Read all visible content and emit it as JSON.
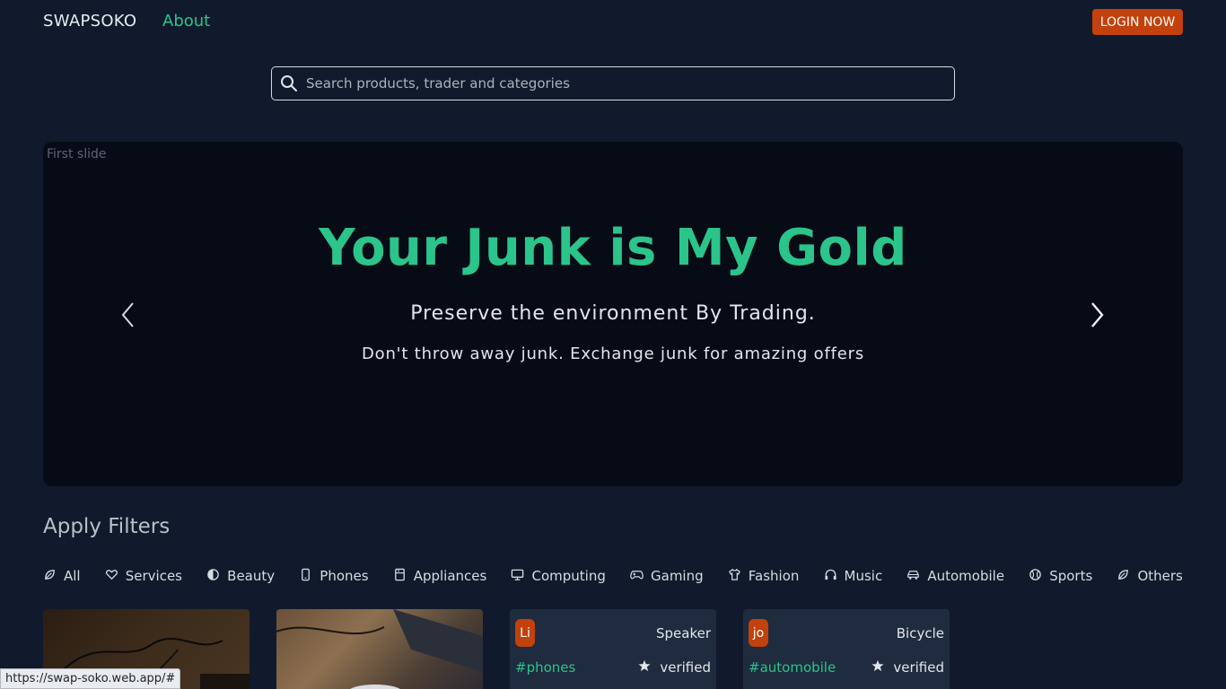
{
  "nav": {
    "brand": "SWAPSOKO",
    "about": "About",
    "login": "LOGIN NOW"
  },
  "search": {
    "placeholder": "Search products, trader and categories"
  },
  "carousel": {
    "alt": "First slide",
    "title": "Your Junk is My Gold",
    "subtitle": "Preserve the environment By Trading.",
    "description": "Don't throw away junk. Exchange junk for amazing offers"
  },
  "filters": {
    "title": "Apply Filters",
    "items": [
      {
        "label": "All",
        "icon": "leaf-icon"
      },
      {
        "label": "Services",
        "icon": "hand-heart-icon"
      },
      {
        "label": "Beauty",
        "icon": "contrast-icon"
      },
      {
        "label": "Phones",
        "icon": "phone-icon"
      },
      {
        "label": "Appliances",
        "icon": "appliance-icon"
      },
      {
        "label": "Computing",
        "icon": "monitor-icon"
      },
      {
        "label": "Gaming",
        "icon": "gamepad-icon"
      },
      {
        "label": "Fashion",
        "icon": "shirt-icon"
      },
      {
        "label": "Music",
        "icon": "headphones-icon"
      },
      {
        "label": "Automobile",
        "icon": "car-icon"
      },
      {
        "label": "Sports",
        "icon": "ball-icon"
      },
      {
        "label": "Others",
        "icon": "leaf-icon"
      }
    ]
  },
  "cards": [
    {
      "avatar": "Li",
      "name": "Speaker",
      "tag": "#phones",
      "status": "verified"
    },
    {
      "avatar": "jo",
      "name": "Bicycle",
      "tag": "#automobile",
      "status": "verified"
    }
  ],
  "status_url": "https://swap-soko.web.app/#",
  "colors": {
    "accent": "#2bc48a",
    "brand_orange": "#c2410c",
    "background": "#101a2c",
    "card": "#1f2b3e"
  }
}
